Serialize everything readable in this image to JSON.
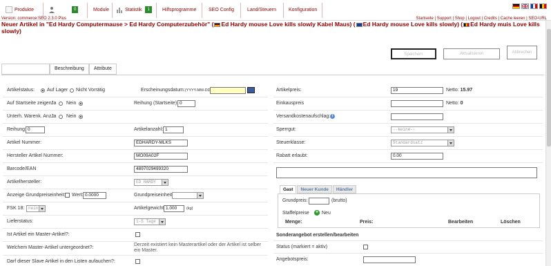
{
  "nav": {
    "produkte": "Produkte",
    "user_badge": "0",
    "module": "Module",
    "statistik": "Statistik",
    "statistik_badge": "1",
    "hilfsprogramme": "Hilfsprogramme",
    "seo_config": "SEO Config",
    "land_steuern": "Land/Steuern",
    "konfiguration": "Konfiguration"
  },
  "version": "Version: commerce:SEO 2.3.0 Plus",
  "toplinks": "Startseite | Support | Shop | Logout | Credits | Cache leeren | SEO-URL",
  "title": {
    "part1": "Neuer Artikel in \"Ed Hardy Computermause > Ed Hardy Computerzubehör\" (",
    "part2": "Ed Hardy mouse Love kills slowly Kabel Maus) (",
    "part3": "Ed Hardy mouse Love kills slowly) (",
    "part4": "Ed Hardy muis Love kills slowly)"
  },
  "buttons": {
    "speichern": "Speichern",
    "aktualisieren": "Aktualisieren",
    "abbrechen": "Abbrechen"
  },
  "tabs": [
    "",
    "Beschreibung",
    "Attribute"
  ],
  "left": {
    "artikelstatus_label": "Artikelstatus:",
    "auf_lager": "Auf Lager",
    "nicht_vorratig": "Nicht Vorrätig",
    "erscheinungsdatum_label": "Erscheinungsdatum:",
    "erscheinungsdatum_hint": "(YYYY-MM-DD)",
    "startseite_label": "Auf Startseite zeigen:",
    "ja": "Ja",
    "nein": "Nein",
    "reihung_startseite_label": "Reihung (Startseite):",
    "reihung_startseite_value": "0",
    "unterh_label": "Unterh. Warenk. Anz.:",
    "reihung_label": "Reihung:",
    "reihung_value": "0",
    "artikelanzahl_label": "Artikelanzahl:",
    "artikelanzahl_value": "1",
    "artikelnummer_label": "Artikel Nummer:",
    "artikelnummer_value": "EDHARDY-MLKS",
    "hersteller_nr_label": "Hersteller Artikel Nummer:",
    "hersteller_nr_value": "MO09A02F",
    "barcode_label": "Barcode/EAN",
    "barcode_value": "4897029499320",
    "artikelhersteller_label": "Artikelhersteller:",
    "artikelhersteller_value": "ED HARDY",
    "grundpreis_label": "Anzeige Grundpreiseinheit:",
    "wert_label": "Wert:",
    "wert_value": "0.0000",
    "grundpreiseinheit_label": "Grundpreiseinheit:",
    "fsk_label": "FSK 18:",
    "fsk_value": "nein",
    "artikelgewicht_label": "Artikelgewicht:",
    "artikelgewicht_value": "1.000",
    "kg": "(kg)",
    "lieferstatus_label": "Lieferstatus:",
    "lieferstatus_value": "1-5 Tage",
    "master_label": "Ist Artikel ein Master-Artikel?:",
    "master_unter_label": "Welchem Master-Artikel untergeordnet?:",
    "master_unter_text": "Derzeit existiert kein Masterartikel oder der Artikel ist selber ein Master.",
    "slave_label": "Darf dieser Slave Artikel in den Listen aufauchen?:"
  },
  "right": {
    "artikelpreis_label": "Artikelpreis:",
    "artikelpreis_value": "19",
    "netto_label": "Netto:",
    "netto_value": "15.97",
    "einkaufspreis_label": "Einkauspreis",
    "einkauf_netto_value": "0",
    "versand_label": "Versandkostenaufschlag:",
    "sperrgut_label": "Sperrgut:",
    "sperrgut_value": "--keine--",
    "steuerklasse_label": "Steuerklasse:",
    "steuerklasse_value": "Standardsatz",
    "rabatt_label": "Rabatt erlaubt:",
    "rabatt_value": "0.00",
    "price_tabs": [
      "Gast",
      "Neuer Kunde",
      "Händler"
    ],
    "grundpreis_label": "Grundpreis:",
    "brutto": "(brutto)",
    "staffelpreise_label": "Staffelpreise",
    "neu": "Neu",
    "col_menge": "Menge:",
    "col_preis": "Preis:",
    "col_bearbeiten": "Bearbeiten",
    "col_loeschen": "Löschen",
    "sonderangebot_heading": "Sonderangebot erstellen/bearbeiten",
    "status_label": "Status (markiert = aktiv)",
    "angebotspreis_label": "Angebotspreis:"
  },
  "colors": {
    "nav_red": "#8b0000",
    "badge_green": "#2b8a2b",
    "date_yellow": "#ffffc0"
  }
}
